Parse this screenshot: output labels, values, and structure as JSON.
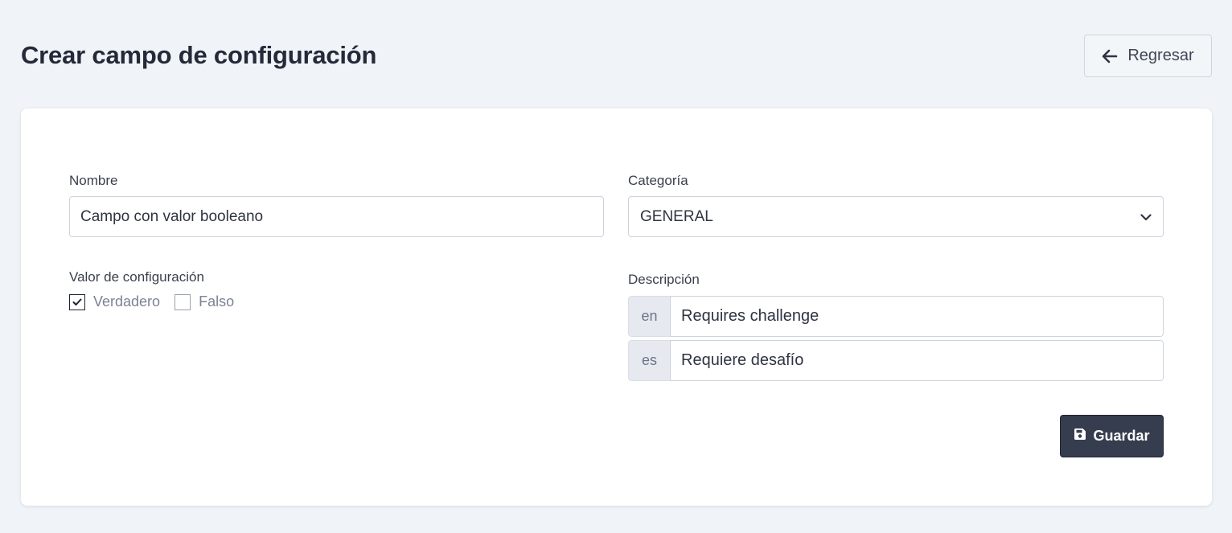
{
  "header": {
    "title": "Crear campo de configuración",
    "back_label": "Regresar"
  },
  "form": {
    "name": {
      "label": "Nombre",
      "value": "Campo con valor booleano"
    },
    "category": {
      "label": "Categoría",
      "value": "GENERAL"
    },
    "config_value": {
      "label": "Valor de configuración",
      "options": [
        {
          "label": "Verdadero",
          "checked": true
        },
        {
          "label": "Falso",
          "checked": false
        }
      ]
    },
    "description": {
      "label": "Descripción",
      "translations": [
        {
          "lang": "en",
          "value": "Requires challenge"
        },
        {
          "lang": "es",
          "value": "Requiere desafío"
        }
      ]
    },
    "save_label": "Guardar"
  },
  "icons": {
    "back": "arrow-left-icon",
    "save": "floppy-disk-icon",
    "dropdown": "chevron-down-icon",
    "check": "checkmark-icon"
  },
  "colors": {
    "background": "#f0f4f8",
    "card": "#ffffff",
    "primary_button": "#363d4f",
    "title_text": "#252a3a"
  }
}
